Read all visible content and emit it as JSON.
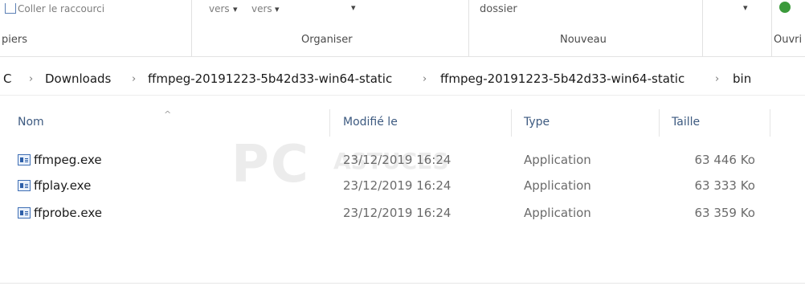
{
  "ribbon": {
    "paste_shortcut_label": "Coller le raccourci",
    "move_to_label": "vers",
    "copy_to_label": "vers",
    "folder_label": "dossier",
    "groups": {
      "clipboard": "piers",
      "organise": "Organiser",
      "new": "Nouveau",
      "open": "Ouvri"
    }
  },
  "address_bar": {
    "segments": [
      "C",
      "Downloads",
      "ffmpeg-20191223-5b42d33-win64-static",
      "ffmpeg-20191223-5b42d33-win64-static",
      "bin"
    ],
    "separator": "›"
  },
  "columns": {
    "name": "Nom",
    "modified": "Modifié le",
    "type": "Type",
    "size": "Taille",
    "sort_caret": "^"
  },
  "files": [
    {
      "name": "ffmpeg.exe",
      "modified": "23/12/2019 16:24",
      "type": "Application",
      "size": "63 446 Ko"
    },
    {
      "name": "ffplay.exe",
      "modified": "23/12/2019 16:24",
      "type": "Application",
      "size": "63 333 Ko"
    },
    {
      "name": "ffprobe.exe",
      "modified": "23/12/2019 16:24",
      "type": "Application",
      "size": "63 359 Ko"
    }
  ],
  "watermark": {
    "main": "PC",
    "sub": "ASTUCES"
  },
  "colors": {
    "column_header": "#3d5a80",
    "exe_icon_accent": "#2d5fa8"
  }
}
